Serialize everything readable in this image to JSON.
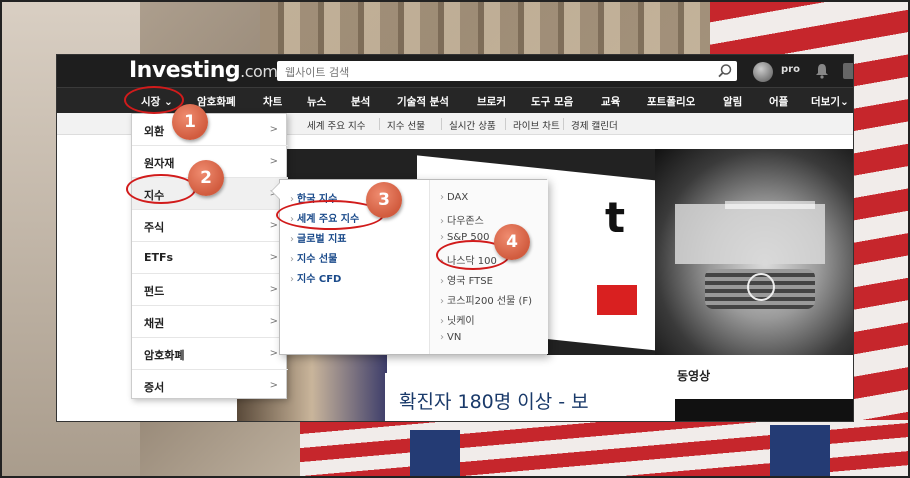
{
  "header": {
    "logo_main": "Investing",
    "logo_suffix": ".com",
    "search_placeholder": "웹사이트 검색",
    "user_label": "pro"
  },
  "navbar": {
    "items": [
      "시장",
      "암호화폐",
      "차트",
      "뉴스",
      "분석",
      "기술적 분석",
      "브로커",
      "도구 모음",
      "교육",
      "포트폴리오",
      "알림",
      "어플",
      "더보기"
    ]
  },
  "subnav": {
    "items": [
      "세계 주요 지수",
      "지수 선물",
      "실시간 상품",
      "라이브 차트",
      "경제 캘린더"
    ]
  },
  "menu1": {
    "items": [
      "외환",
      "원자재",
      "지수",
      "주식",
      "ETFs",
      "펀드",
      "채권",
      "암호화폐",
      "증서"
    ]
  },
  "menu2": {
    "left": [
      "한국 지수",
      "세계 주요 지수",
      "글로벌 지표",
      "지수 선물",
      "지수 CFD"
    ],
    "right": [
      "DAX",
      "다우존스",
      "S&P 500",
      "나스닥 100",
      "영국 FTSE",
      "코스피200 선물 (F)",
      "닛케이",
      "VN"
    ]
  },
  "content": {
    "headline": "확진자 180명 이상 - 보",
    "video_title": "동영상",
    "hero_text": "t"
  },
  "annotations": {
    "badges": [
      "1",
      "2",
      "3",
      "4"
    ]
  },
  "colors": {
    "topbar": "#1e1e1e",
    "navbar": "#262626",
    "badge": "#d15b3e",
    "ring": "#d11b1b",
    "link": "#1a4a8a"
  }
}
